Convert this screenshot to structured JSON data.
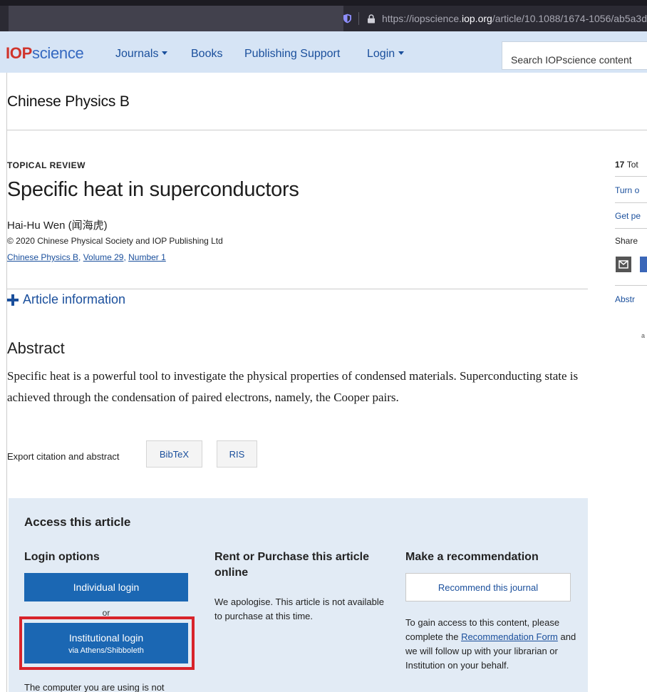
{
  "browser": {
    "url_prefix": "https://iopscience.",
    "url_host": "iop.org",
    "url_path": "/article/10.1088/1674-1056/ab5a3d"
  },
  "nav": {
    "logo_iop": "IOP",
    "logo_science": "science",
    "journals": "Journals",
    "books": "Books",
    "publishing_support": "Publishing Support",
    "login": "Login",
    "search_placeholder": "Search IOPscience content"
  },
  "journal_title": "Chinese Physics B",
  "article": {
    "type": "TOPICAL REVIEW",
    "title": "Specific heat in superconductors",
    "author": "Hai-Hu Wen (闻海虎)",
    "copyright": "© 2020 Chinese Physical Society and IOP Publishing Ltd",
    "journal_link": "Chinese Physics B",
    "volume_link": "Volume 29",
    "number_link": "Number 1",
    "comma": ", ",
    "article_info": "Article information"
  },
  "abstract": {
    "heading": "Abstract",
    "text": "Specific heat is a powerful tool to investigate the physical properties of condensed materials. Superconducting state is achieved through the condensation of paired electrons, namely, the Cooper pairs."
  },
  "export": {
    "label": "Export citation and abstract",
    "bibtex": "BibTeX",
    "ris": "RIS"
  },
  "access": {
    "heading": "Access this article",
    "login": {
      "heading": "Login options",
      "individual": "Individual login",
      "or": "or",
      "institutional": "Institutional login",
      "institutional_sub": "via Athens/Shibboleth",
      "note": "The computer you are using is not"
    },
    "rent": {
      "heading": "Rent or Purchase this article online",
      "text": "We apologise. This article is not available to purchase at this time."
    },
    "recommend": {
      "heading": "Make a recommendation",
      "button": "Recommend this journal",
      "text_before": "To gain access to this content, please complete the",
      "form_link": "Recommendation Form",
      "text_after": "and we will follow up with your librarian or Institution on your behalf."
    }
  },
  "sidebar": {
    "total_count": "17",
    "total_label": "Tot",
    "turn_on": "Turn o",
    "get_permission": "Get pe",
    "share": "Share",
    "abstract": "Abstr",
    "fragment": "a"
  }
}
